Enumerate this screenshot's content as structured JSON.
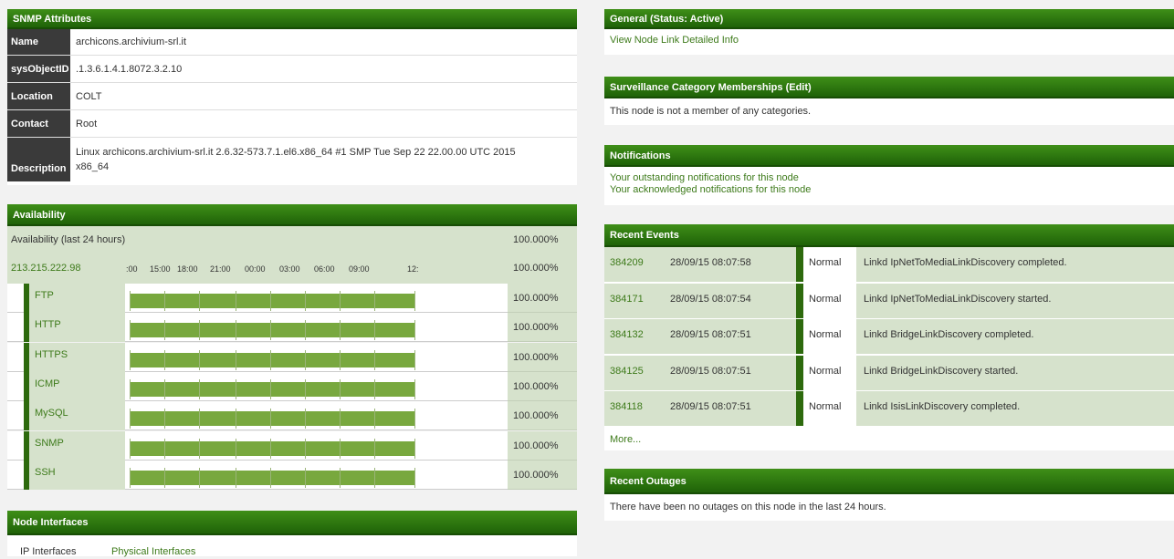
{
  "snmp": {
    "header": "SNMP Attributes",
    "rows": [
      {
        "key": "Name",
        "value": "archicons.archivium-srl.it"
      },
      {
        "key": "sysObjectID",
        "value": ".1.3.6.1.4.1.8072.3.2.10"
      },
      {
        "key": "Location",
        "value": "COLT"
      },
      {
        "key": "Contact",
        "value": "Root"
      },
      {
        "key": "Description",
        "value": "Linux archicons.archivium-srl.it 2.6.32-573.7.1.el6.x86_64 #1 SMP Tue Sep 22 22.00.00 UTC 2015 x86_64"
      }
    ]
  },
  "availability": {
    "header": "Availability",
    "summary_label": "Availability (last 24 hours)",
    "summary_pct": "100.000%",
    "ip": "213.215.222.98",
    "ip_pct": "100.000%",
    "time_ticks": [
      ":00",
      "15:00",
      "18:00",
      "21:00",
      "00:00",
      "03:00",
      "06:00",
      "09:00",
      "12:"
    ],
    "services": [
      {
        "name": "FTP",
        "pct": "100.000%",
        "availability": 1.0
      },
      {
        "name": "HTTP",
        "pct": "100.000%",
        "availability": 1.0
      },
      {
        "name": "HTTPS",
        "pct": "100.000%",
        "availability": 1.0
      },
      {
        "name": "ICMP",
        "pct": "100.000%",
        "availability": 1.0
      },
      {
        "name": "MySQL",
        "pct": "100.000%",
        "availability": 1.0
      },
      {
        "name": "SNMP",
        "pct": "100.000%",
        "availability": 1.0
      },
      {
        "name": "SSH",
        "pct": "100.000%",
        "availability": 1.0
      }
    ]
  },
  "node_interfaces": {
    "header": "Node Interfaces",
    "tabs": [
      "IP Interfaces",
      "Physical Interfaces"
    ]
  },
  "general": {
    "header": "General (Status: Active)",
    "link": "View Node Link Detailed Info"
  },
  "surveillance": {
    "header": "Surveillance Category Memberships (Edit)",
    "text": "This node is not a member of any categories."
  },
  "notifications": {
    "header": "Notifications",
    "links": [
      "Your outstanding notifications for this node",
      "Your acknowledged notifications for this node"
    ]
  },
  "events": {
    "header": "Recent Events",
    "rows": [
      {
        "id": "384209",
        "time": "28/09/15 08:07:58",
        "severity": "Normal",
        "message": "Linkd IpNetToMediaLinkDiscovery completed."
      },
      {
        "id": "384171",
        "time": "28/09/15 08:07:54",
        "severity": "Normal",
        "message": "Linkd IpNetToMediaLinkDiscovery started."
      },
      {
        "id": "384132",
        "time": "28/09/15 08:07:51",
        "severity": "Normal",
        "message": "Linkd BridgeLinkDiscovery completed."
      },
      {
        "id": "384125",
        "time": "28/09/15 08:07:51",
        "severity": "Normal",
        "message": "Linkd BridgeLinkDiscovery started."
      },
      {
        "id": "384118",
        "time": "28/09/15 08:07:51",
        "severity": "Normal",
        "message": "Linkd IsisLinkDiscovery completed."
      }
    ],
    "more": "More..."
  },
  "outages": {
    "header": "Recent Outages",
    "text": "There have been no outages on this node in the last 24 hours."
  },
  "colors": {
    "header": "#2f7a10",
    "row_tint": "#d6e2cc",
    "bar": "#78a83e",
    "link": "#3d7a1a"
  }
}
